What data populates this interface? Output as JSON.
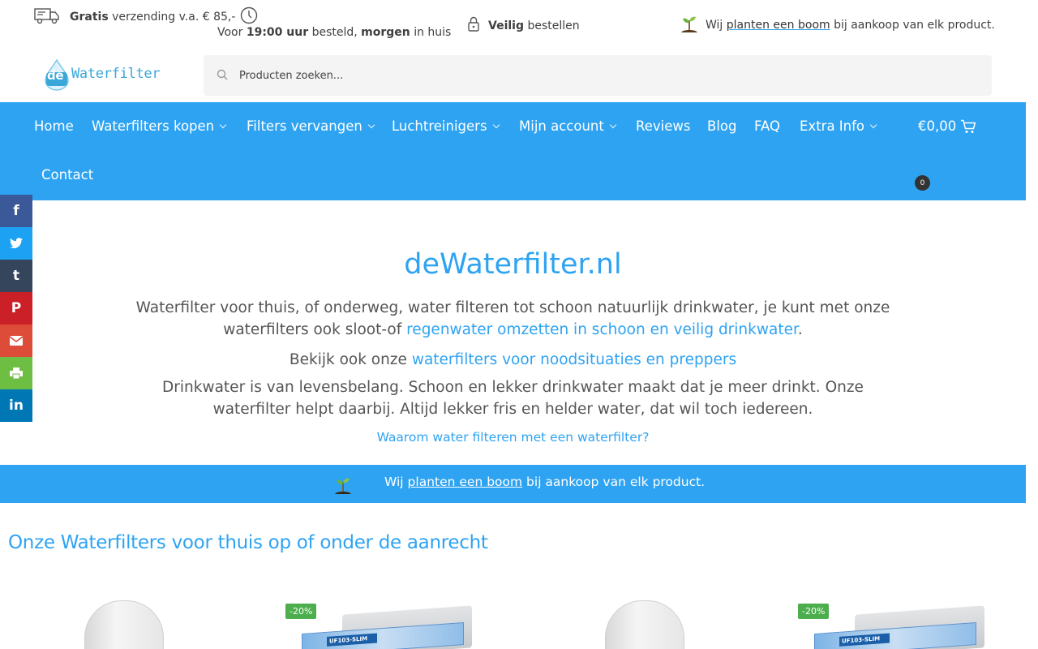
{
  "usp": {
    "shipping_bold": "Gratis",
    "shipping_rest": "verzending v.a. € 85,-",
    "order_prefix": "Voor",
    "order_time": "19:00 uur",
    "order_mid": "besteld,",
    "order_day": "morgen",
    "order_suffix": "in huis",
    "secure_bold": "Veilig",
    "secure_rest": "bestellen",
    "tree_prefix": "Wij",
    "tree_link": "planten een boom",
    "tree_suffix": "bij aankoop van elk product."
  },
  "logo": {
    "de": "de",
    "name": "Waterfilter"
  },
  "search": {
    "placeholder": "Producten zoeken..."
  },
  "nav": {
    "items": [
      {
        "label": "Home"
      },
      {
        "label": "Waterfilters kopen"
      },
      {
        "label": "Filters vervangen"
      },
      {
        "label": "Luchtreinigers"
      },
      {
        "label": "Mijn account"
      },
      {
        "label": "Reviews"
      },
      {
        "label": "Blog"
      },
      {
        "label": "FAQ"
      },
      {
        "label": "Extra Info"
      },
      {
        "label": "Contact"
      }
    ],
    "cart_total": "€0,00",
    "cart_count": "0"
  },
  "social": [
    "f",
    "t",
    "t",
    "p",
    "mail",
    "print",
    "in"
  ],
  "hero": {
    "title": "deWaterfilter.nl",
    "p1_text": "Waterfilter voor thuis, of onderweg, water filteren tot schoon natuurlijk drinkwater, je kunt met onze waterfilters ook sloot-of ",
    "p1_link": "regenwater omzetten in schoon en veilig drinkwater",
    "p1_end": ".",
    "p2_text": "Bekijk ook onze ",
    "p2_link": "waterfilters voor noodsituaties en preppers",
    "p3_text": "Drinkwater is van levensbelang. Schoon en lekker drinkwater maakt dat je meer drinkt. Onze waterfilter helpt daarbij. Altijd lekker fris en helder water, dat wil toch iedereen.",
    "why_link": "Waarom water filteren met een waterfilter?"
  },
  "banner": {
    "prefix": "Wij",
    "link": "planten een boom",
    "suffix": "bij aankoop van elk product."
  },
  "section": {
    "title": "Onze Waterfilters voor thuis op of onder de aanrecht"
  },
  "products": {
    "badge_2": "-20%",
    "badge_4": "-20%",
    "kit_label": "UF103-SLIM"
  },
  "colors": {
    "accent": "#2ea3f2",
    "sale": "#4cae4c"
  }
}
